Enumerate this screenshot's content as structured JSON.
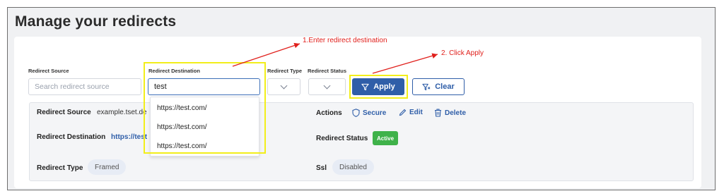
{
  "page": {
    "title": "Manage your redirects"
  },
  "filters": {
    "source_label": "Redirect Source",
    "source_placeholder": "Search redirect source",
    "destination_label": "Redirect Destination",
    "destination_value": "test",
    "type_label": "Redirect Type",
    "status_label": "Redirect Status",
    "apply_label": "Apply",
    "clear_label": "Clear"
  },
  "dropdown": {
    "options": [
      "https://test.com/",
      "https://test.com/",
      "https://test.com/"
    ]
  },
  "details": {
    "source_label": "Redirect Source",
    "source_value": "example.tset.de",
    "destination_label": "Redirect Destination",
    "destination_value": "https://test",
    "type_label": "Redirect Type",
    "type_value": "Framed",
    "actions_label": "Actions",
    "secure_label": "Secure",
    "edit_label": "Edit",
    "delete_label": "Delete",
    "status_label": "Redirect Status",
    "status_value": "Active",
    "ssl_label": "Ssl",
    "ssl_value": "Disabled"
  },
  "annotations": {
    "step1": "1.Enter redirect destination",
    "step2": "2. Click Apply"
  },
  "colors": {
    "primary": "#2f5ea8",
    "active_badge": "#3fb24a",
    "highlight": "#f2ee1a",
    "annotation": "#e0201c"
  }
}
